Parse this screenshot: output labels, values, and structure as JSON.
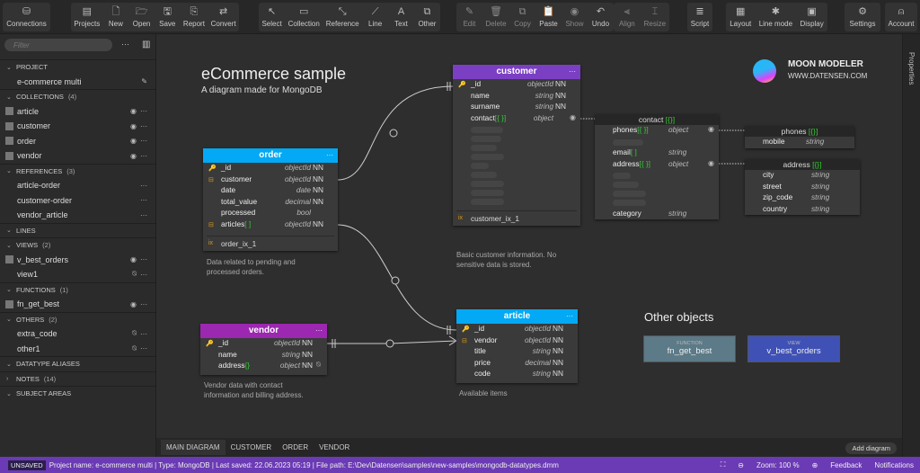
{
  "toolbar": {
    "groups": [
      [
        {
          "label": "Connections",
          "icon": "database-icon",
          "g": "⛁"
        }
      ],
      [
        {
          "label": "Projects",
          "icon": "projects-icon",
          "g": "▤"
        },
        {
          "label": "New",
          "icon": "new-file-icon",
          "g": "🗋"
        },
        {
          "label": "Open",
          "icon": "folder-open-icon",
          "g": "🗁"
        },
        {
          "label": "Save",
          "icon": "save-icon",
          "g": "🖫"
        },
        {
          "label": "Report",
          "icon": "report-icon",
          "g": "⎘"
        },
        {
          "label": "Convert",
          "icon": "convert-icon",
          "g": "⇄"
        }
      ],
      [
        {
          "label": "Select",
          "icon": "cursor-icon",
          "g": "↖"
        },
        {
          "label": "Collection",
          "icon": "collection-icon",
          "g": "▭"
        },
        {
          "label": "Reference",
          "icon": "reference-icon",
          "g": "⤡"
        },
        {
          "label": "Line",
          "icon": "line-icon",
          "g": "⟋"
        },
        {
          "label": "Text",
          "icon": "text-icon",
          "g": "A"
        },
        {
          "label": "Other",
          "icon": "other-icon",
          "g": "⧉"
        }
      ],
      [
        {
          "label": "Edit",
          "icon": "pencil-icon",
          "g": "✎",
          "dim": true
        },
        {
          "label": "Delete",
          "icon": "trash-icon",
          "g": "🗑",
          "dim": true
        },
        {
          "label": "Copy",
          "icon": "copy-icon",
          "g": "⧉",
          "dim": true
        },
        {
          "label": "Paste",
          "icon": "paste-icon",
          "g": "📋"
        },
        {
          "label": "Show",
          "icon": "eye-icon",
          "g": "◉",
          "dim": true
        },
        {
          "label": "Undo",
          "icon": "undo-icon",
          "g": "↶"
        }
      ],
      [
        {
          "label": "Align",
          "icon": "align-icon",
          "g": "⫷",
          "dim": true
        },
        {
          "label": "Resize",
          "icon": "resize-icon",
          "g": "⌶",
          "dim": true
        }
      ],
      [
        {
          "label": "Script",
          "icon": "script-icon",
          "g": "≣"
        }
      ],
      [
        {
          "label": "Layout",
          "icon": "layout-icon",
          "g": "▦"
        },
        {
          "label": "Line mode",
          "icon": "line-mode-icon",
          "g": "✱"
        },
        {
          "label": "Display",
          "icon": "display-icon",
          "g": "▣"
        }
      ],
      [
        {
          "label": "Settings",
          "icon": "gear-icon",
          "g": "⚙"
        }
      ],
      [
        {
          "label": "Account",
          "icon": "user-icon",
          "g": "⍝"
        }
      ]
    ]
  },
  "sidebar": {
    "filter_placeholder": "Filter",
    "sections": [
      {
        "title": "PROJECT",
        "count": "",
        "open": true,
        "items": [
          {
            "label": "e-commerce multi",
            "cb": false,
            "eye": "",
            "edit": true
          }
        ]
      },
      {
        "title": "COLLECTIONS",
        "count": "(4)",
        "open": true,
        "items": [
          {
            "label": "article",
            "cb": true,
            "eye": "◉"
          },
          {
            "label": "customer",
            "cb": true,
            "eye": "◉"
          },
          {
            "label": "order",
            "cb": true,
            "eye": "◉"
          },
          {
            "label": "vendor",
            "cb": true,
            "eye": "◉"
          }
        ]
      },
      {
        "title": "REFERENCES",
        "count": "(3)",
        "open": true,
        "items": [
          {
            "label": "article-order",
            "cb": false,
            "eye": ""
          },
          {
            "label": "customer-order",
            "cb": false,
            "eye": ""
          },
          {
            "label": "vendor_article",
            "cb": false,
            "eye": ""
          }
        ]
      },
      {
        "title": "LINES",
        "count": "",
        "open": true,
        "items": []
      },
      {
        "title": "VIEWS",
        "count": "(2)",
        "open": true,
        "items": [
          {
            "label": "v_best_orders",
            "cb": true,
            "eye": "◉"
          },
          {
            "label": "view1",
            "cb": false,
            "eye": "⍉"
          }
        ]
      },
      {
        "title": "FUNCTIONS",
        "count": "(1)",
        "open": true,
        "items": [
          {
            "label": "fn_get_best",
            "cb": true,
            "eye": "◉"
          }
        ]
      },
      {
        "title": "OTHERS",
        "count": "(2)",
        "open": true,
        "items": [
          {
            "label": "extra_code",
            "cb": false,
            "eye": "⍉"
          },
          {
            "label": "other1",
            "cb": false,
            "eye": "⍉"
          }
        ]
      },
      {
        "title": "DATATYPE ALIASES",
        "count": "",
        "open": true,
        "items": []
      },
      {
        "title": "NOTES",
        "count": "(14)",
        "open": false,
        "items": []
      },
      {
        "title": "SUBJECT AREAS",
        "count": "",
        "open": true,
        "items": []
      }
    ]
  },
  "diagram": {
    "title": "eCommerce sample",
    "subtitle": "A diagram made for MongoDB",
    "logo_title": "MOON MODELER",
    "logo_url": "WWW.DATENSEN.COM",
    "other_title": "Other objects",
    "others": [
      {
        "kind": "FUNCTION",
        "name": "fn_get_best",
        "color": "#5c7a87"
      },
      {
        "kind": "VIEW",
        "name": "v_best_orders",
        "color": "#3f51b5"
      }
    ]
  },
  "entities": {
    "order": {
      "title": "order",
      "color": "#03a9f4",
      "rows": [
        {
          "icon": "pk",
          "name": "_id",
          "type": "objectId",
          "nn": "NN"
        },
        {
          "icon": "fk",
          "name": "customer",
          "type": "objectId",
          "nn": "NN"
        },
        {
          "name": "date",
          "type": "date",
          "nn": "NN"
        },
        {
          "name": "total_value",
          "type": "decimal",
          "nn": "NN"
        },
        {
          "name": "processed",
          "type": "bool",
          "nn": ""
        },
        {
          "icon": "fk",
          "name": "articles",
          "suffix": "[ ]",
          "type": "objectId",
          "nn": "NN"
        }
      ],
      "index": "order_ix_1",
      "note": "Data related to pending and processed orders."
    },
    "customer": {
      "title": "customer",
      "color": "#7b3fc4",
      "rows": [
        {
          "icon": "pk",
          "name": "_id",
          "type": "objectId",
          "nn": "NN"
        },
        {
          "name": "name",
          "type": "string",
          "nn": "NN"
        },
        {
          "name": "surname",
          "type": "string",
          "nn": "NN"
        },
        {
          "name": "contact",
          "suffix": "[{ }]",
          "type": "object",
          "nn": "",
          "eye": true
        },
        {
          "ph": 36
        },
        {
          "ph": 34
        },
        {
          "ph": 29
        },
        {
          "ph": 37
        },
        {
          "ph": 20
        },
        {
          "ph": 29
        },
        {
          "ph": 37
        },
        {
          "ph": 37
        },
        {
          "ph": 37
        }
      ],
      "index": "customer_ix_1",
      "note": "Basic customer information. No sensitive data is stored."
    },
    "contact": {
      "title": "contact",
      "suffix": "[{}]",
      "sub": true,
      "rows": [
        {
          "name": "phones",
          "suffix": "[{ }]",
          "type": "object",
          "eye": true
        },
        {
          "ph": 34
        },
        {
          "name": "email",
          "suffix": "[ ]",
          "type": "string"
        },
        {
          "name": "address",
          "suffix": "[{ }]",
          "type": "object",
          "eye": true
        },
        {
          "ph": 20
        },
        {
          "ph": 29
        },
        {
          "ph": 37
        },
        {
          "ph": 37
        },
        {
          "name": "category",
          "type": "string"
        }
      ]
    },
    "phones": {
      "title": "phones",
      "suffix": "[{}]",
      "sub": true,
      "rows": [
        {
          "name": "mobile",
          "type": "string"
        }
      ]
    },
    "address": {
      "title": "address",
      "suffix": "[{}]",
      "sub": true,
      "rows": [
        {
          "name": "city",
          "type": "string"
        },
        {
          "name": "street",
          "type": "string"
        },
        {
          "name": "zip_code",
          "type": "string"
        },
        {
          "name": "country",
          "type": "string"
        }
      ]
    },
    "vendor": {
      "title": "vendor",
      "color": "#9c27b0",
      "rows": [
        {
          "icon": "pk",
          "name": "_id",
          "type": "objectId",
          "nn": "NN"
        },
        {
          "name": "name",
          "type": "string",
          "nn": "NN"
        },
        {
          "name": "address",
          "suffix": "{}",
          "type": "object",
          "nn": "NN",
          "hidden": true
        }
      ],
      "note": "Vendor data with contact information and billing address."
    },
    "article": {
      "title": "article",
      "color": "#03a9f4",
      "rows": [
        {
          "icon": "pk",
          "name": "_id",
          "type": "objectId",
          "nn": "NN"
        },
        {
          "icon": "fk",
          "name": "vendor",
          "type": "objectId",
          "nn": "NN"
        },
        {
          "name": "title",
          "type": "string",
          "nn": "NN"
        },
        {
          "name": "price",
          "type": "decimal",
          "nn": "NN"
        },
        {
          "name": "code",
          "type": "string",
          "nn": "NN"
        }
      ],
      "note": "Available items"
    }
  },
  "tabs": [
    "MAIN DIAGRAM",
    "CUSTOMER",
    "ORDER",
    "VENDOR"
  ],
  "add_diagram": "Add diagram",
  "right_panel": "Properties",
  "status": {
    "unsaved": "UNSAVED",
    "text": "Project name: e-commerce multi   | Type: MongoDB | Last saved: 22.06.2023 05:19   | File path: E:\\Dev\\Datensen\\samples\\new-samples\\mongodb-datatypes.dmm",
    "zoom": "Zoom: 100 %",
    "feedback": "Feedback",
    "notifications": "Notifications"
  }
}
